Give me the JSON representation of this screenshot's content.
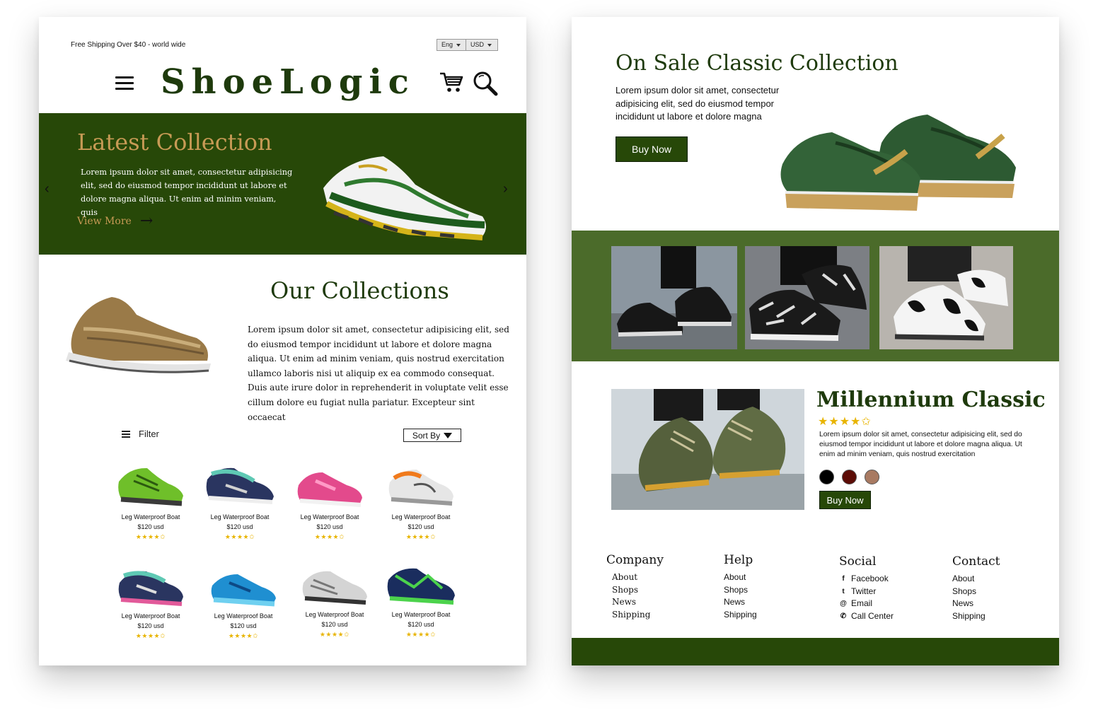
{
  "left_page": {
    "top_bar": {
      "shipping_text": "Free Shipping Over $40 - world wide",
      "language": "Eng",
      "currency": "USD"
    },
    "header": {
      "logo": "ShoeLogic",
      "icons": [
        "menu-icon",
        "cart-icon",
        "search-icon"
      ]
    },
    "hero": {
      "title": "Latest Collection",
      "text": "Lorem ipsum dolor sit amet, consectetur adipisicing elit, sed do eiusmod tempor incididunt ut labore et dolore magna aliqua. Ut enim ad minim veniam, quis",
      "link": "View More",
      "prev_glyph": "‹",
      "next_glyph": "›",
      "arrow_glyph": "→"
    },
    "collections": {
      "title": "Our Collections",
      "text": "Lorem ipsum dolor sit amet, consectetur adipisicing elit, sed do eiusmod tempor incididunt ut labore et dolore magna aliqua. Ut enim ad minim veniam, quis nostrud exercitation ullamco laboris nisi ut aliquip ex ea commodo consequat. Duis aute irure dolor in reprehenderit in voluptate velit esse cillum dolore eu fugiat nulla pariatur. Excepteur sint occaecat"
    },
    "toolbar": {
      "filter_label": "Filter",
      "sort_label": "Sort By"
    },
    "products": [
      {
        "name": "Leg Waterproof Boat",
        "price": "$120 usd",
        "stars": "★★★★✩",
        "rating": 4.5
      },
      {
        "name": "Leg Waterproof Boat",
        "price": "$120 usd",
        "stars": "★★★★✩",
        "rating": 4.5
      },
      {
        "name": "Leg Waterproof Boat",
        "price": "$120 usd",
        "stars": "★★★★✩",
        "rating": 4.5
      },
      {
        "name": "Leg Waterproof Boat",
        "price": "$120 usd",
        "stars": "★★★★✩",
        "rating": 4.5
      },
      {
        "name": "Leg Waterproof Boat",
        "price": "$120 usd",
        "stars": "★★★★✩",
        "rating": 4.5
      },
      {
        "name": "Leg Waterproof Boat",
        "price": "$120 usd",
        "stars": "★★★★✩",
        "rating": 4.5
      },
      {
        "name": "Leg Waterproof Boat",
        "price": "$120 usd",
        "stars": "★★★★✩",
        "rating": 4.5
      },
      {
        "name": "Leg Waterproof Boat",
        "price": "$120 usd",
        "stars": "★★★★✩",
        "rating": 4.5
      }
    ]
  },
  "right_page": {
    "sale": {
      "title": "On Sale Classic Collection",
      "text": "Lorem ipsum dolor sit amet, consectetur adipisicing elit, sed do eiusmod tempor incididunt ut labore et dolore magna",
      "button": "Buy Now"
    },
    "featured": {
      "title": "Millennium Classic",
      "stars": "★★★★✩",
      "rating": 4.5,
      "text": "Lorem ipsum dolor sit amet, consectetur adipisicing elit, sed do eiusmod tempor incididunt ut labore et dolore magna aliqua. Ut enim ad minim veniam, quis nostrud exercitation",
      "colors": [
        "#000000",
        "#5c0c06",
        "#a87a62"
      ],
      "button": "Buy Now"
    },
    "footer": {
      "company": {
        "heading": "Company",
        "links": [
          "About",
          "Shops",
          "News",
          "Shipping"
        ]
      },
      "help": {
        "heading": "Help",
        "links": [
          "About",
          "Shops",
          "News",
          "Shipping"
        ]
      },
      "social": {
        "heading": "Social",
        "links": [
          "Facebook",
          "Twitter",
          "Email",
          "Call Center"
        ],
        "icons": [
          "facebook-icon",
          "twitter-icon",
          "email-icon",
          "phone-icon"
        ],
        "glyphs": [
          "f",
          "t",
          "@",
          "✆"
        ]
      },
      "contact": {
        "heading": "Contact",
        "links": [
          "About",
          "Shops",
          "News",
          "Shipping"
        ]
      }
    }
  },
  "colors": {
    "brand_green": "#274808",
    "gallery_green": "#4b6b2a",
    "gold": "#c79a55",
    "star": "#e8b400"
  }
}
